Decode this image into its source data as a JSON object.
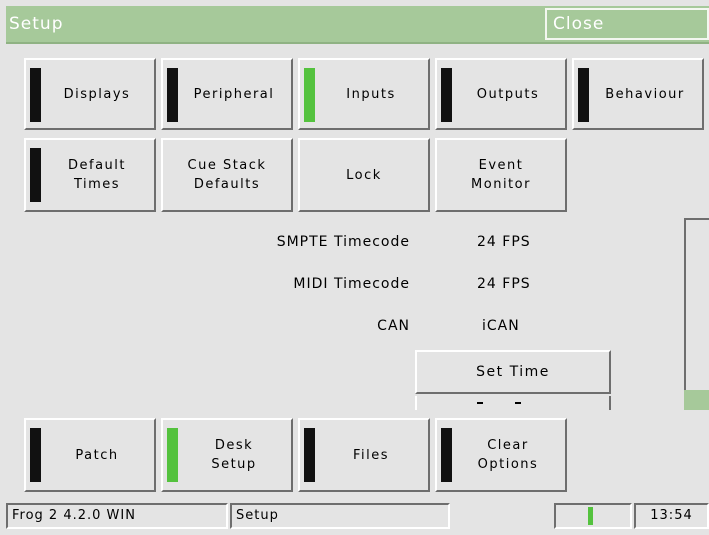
{
  "window": {
    "title": "Setup",
    "close_label": "Close"
  },
  "colors": {
    "title_bar": "#a6c99a",
    "lamp_on": "#54c23e",
    "lamp_off": "#111111",
    "panel": "#e4e4e4"
  },
  "top_row": [
    {
      "label": "Displays",
      "lamp": "off"
    },
    {
      "label": "Peripheral",
      "lamp": "off"
    },
    {
      "label": "Inputs",
      "lamp": "on"
    },
    {
      "label": "Outputs",
      "lamp": "off"
    },
    {
      "label": "Behaviour",
      "lamp": "off"
    }
  ],
  "second_row": [
    {
      "label": "Default\nTimes",
      "lamp": "off"
    },
    {
      "label": "Cue Stack\nDefaults"
    },
    {
      "label": "Lock"
    },
    {
      "label": "Event\nMonitor"
    }
  ],
  "info": [
    {
      "label": "SMPTE Timecode",
      "value": "24 FPS"
    },
    {
      "label": "MIDI Timecode",
      "value": "24 FPS"
    },
    {
      "label": "CAN",
      "value": "iCAN"
    }
  ],
  "set_time_label": "Set Time",
  "bottom_row": [
    {
      "label": "Patch",
      "lamp": "off"
    },
    {
      "label": "Desk\nSetup",
      "lamp": "on"
    },
    {
      "label": "Files",
      "lamp": "off"
    },
    {
      "label": "Clear\nOptions",
      "lamp": "off"
    }
  ],
  "status_bar": {
    "version": "Frog 2 4.2.0 WIN",
    "section": "Setup",
    "clock": "13:54"
  }
}
